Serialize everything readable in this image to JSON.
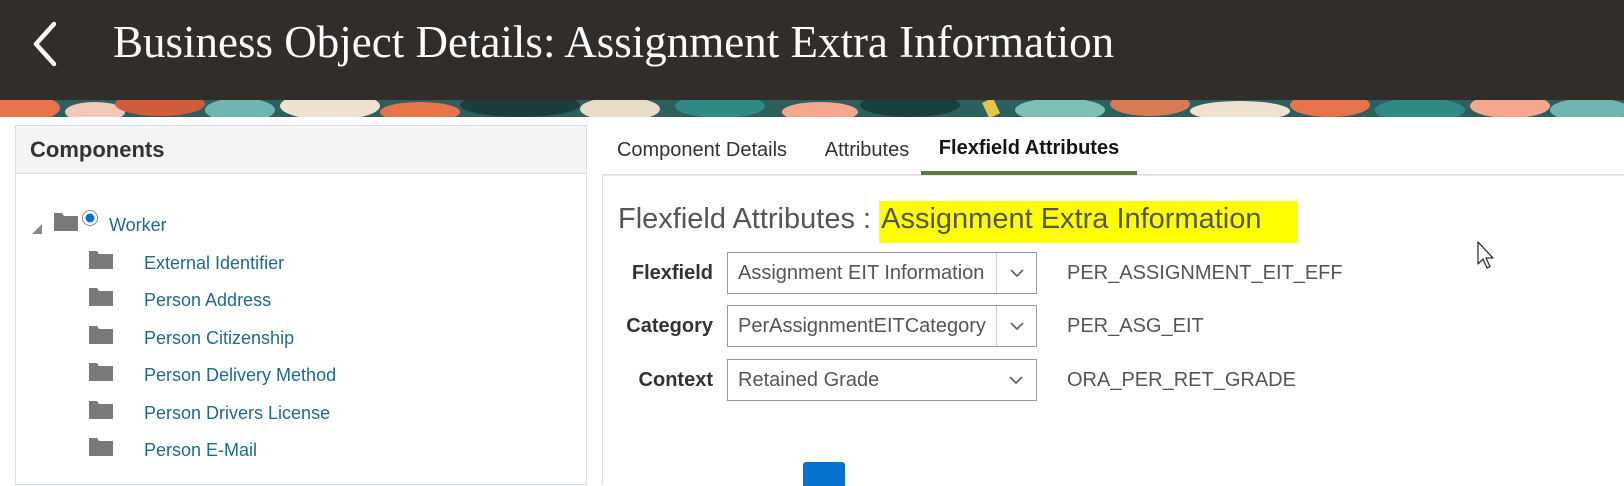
{
  "header": {
    "title": "Business Object Details: Assignment Extra Information",
    "back_icon": "chevron-left-icon"
  },
  "components": {
    "title": "Components",
    "tree": [
      {
        "label": "Worker",
        "level": 0,
        "selected": true,
        "expanded": true
      },
      {
        "label": "External Identifier",
        "level": 1
      },
      {
        "label": "Person Address",
        "level": 1
      },
      {
        "label": "Person Citizenship",
        "level": 1
      },
      {
        "label": "Person Delivery Method",
        "level": 1
      },
      {
        "label": "Person Drivers License",
        "level": 1
      },
      {
        "label": "Person E-Mail",
        "level": 1
      }
    ]
  },
  "tabs": [
    {
      "label": "Component Details",
      "active": false
    },
    {
      "label": "Attributes",
      "active": false
    },
    {
      "label": "Flexfield Attributes",
      "active": true
    }
  ],
  "flexfield": {
    "title_prefix": "Flexfield Attributes : ",
    "title_highlight": "Assignment Extra Information",
    "fields": [
      {
        "label": "Flexfield",
        "value": "Assignment EIT Information",
        "code": "PER_ASSIGNMENT_EIT_EFF"
      },
      {
        "label": "Category",
        "value": "PerAssignmentEITCategory",
        "code": "PER_ASG_EIT"
      },
      {
        "label": "Context",
        "value": "Retained Grade",
        "code": "ORA_PER_RET_GRADE"
      }
    ]
  },
  "colors": {
    "header_bg": "#312d2a",
    "link": "#1e6a8f",
    "active_tab_underline": "#5b7d3a",
    "highlight": "#ffff00",
    "primary_button": "#0572ce"
  }
}
